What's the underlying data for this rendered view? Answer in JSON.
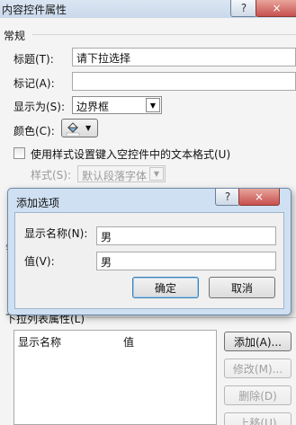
{
  "outer_window": {
    "title": "内容控件属性",
    "help_label": "?",
    "close_label": "×",
    "general_group": "常规",
    "title_label": "标题(T):",
    "title_value": "请下拉选择",
    "tag_label": "标记(A):",
    "tag_value": "",
    "show_as_label": "显示为(S):",
    "show_as_value": "边界框",
    "color_label": "颜色(C):",
    "style_checkbox_label": "使用样式设置键入空控件中的文本格式(U)",
    "style_label": "样式(S):",
    "style_value": "默认段落字体",
    "dropdown_props_label": "下拉列表属性(L)",
    "table_headers": [
      "显示名称",
      "值"
    ],
    "add_button": "添加(A)...",
    "modify_button": "修改(M)...",
    "delete_button": "删除(D)",
    "move_up_button": "上移(U)"
  },
  "dialog": {
    "title": "添加选项",
    "help_label": "?",
    "close_label": "×",
    "display_name_label": "显示名称(N):",
    "display_name_value": "男",
    "value_label": "值(V):",
    "value_value": "男",
    "ok_button": "确定",
    "cancel_button": "取消"
  },
  "icons": {
    "color_picker": "paint-bucket-icon",
    "dropdown": "triangle-down-icon",
    "help": "question-mark-icon",
    "close": "close-icon"
  },
  "colors": {
    "dialog_frame": "#cfe0f2",
    "close_button": "#c75050",
    "default_button_border": "#3c7fb1"
  }
}
